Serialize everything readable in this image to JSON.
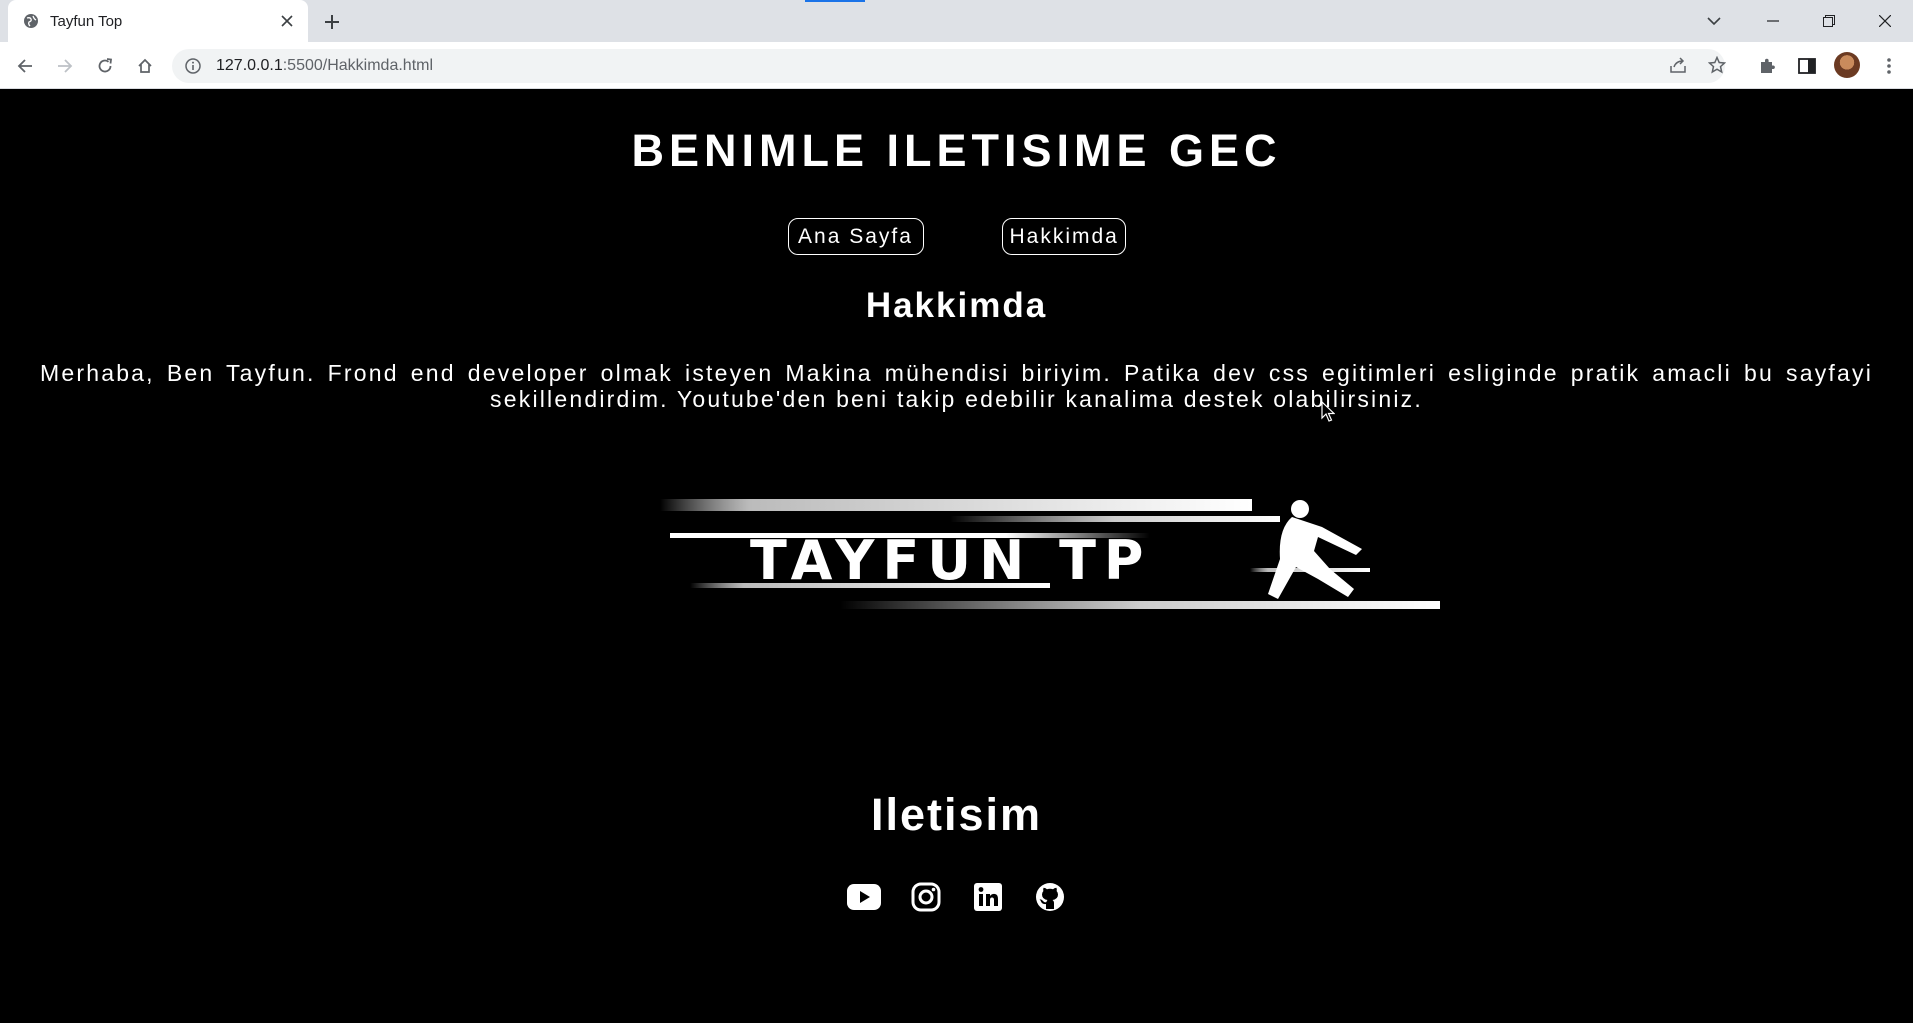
{
  "browser": {
    "tab_title": "Tayfun Top",
    "url_host": "127.0.0.1",
    "url_path": ":5500/Hakkimda.html",
    "icons": {
      "favicon": "globe-icon",
      "close": "close-icon",
      "new_tab": "plus-icon",
      "tab_search": "chevron-down-icon",
      "minimize": "minimize-icon",
      "restore": "restore-icon",
      "window_close": "close-icon",
      "back": "back-arrow-icon",
      "forward": "forward-arrow-icon",
      "reload": "reload-icon",
      "home": "home-icon",
      "site_info": "info-icon",
      "share": "share-icon",
      "bookmark": "star-icon",
      "extensions": "puzzle-icon",
      "side_panel": "side-panel-icon",
      "profile": "avatar",
      "menu": "kebab-menu-icon"
    }
  },
  "page": {
    "site_title": "BENIMLE ILETISIME GEC",
    "nav": [
      {
        "label": "Ana Sayfa"
      },
      {
        "label": "Hakkimda"
      }
    ],
    "section_title": "Hakkimda",
    "about_text": "Merhaba, Ben Tayfun. Frond end developer olmak isteyen Makina mühendisi biriyim. Patika dev css egitimleri esliginde pratik amacli bu sayfayi sekillendirdim. Youtube'den beni takip edebilir kanalima destek olabilirsiniz.",
    "logo_text": "TAYFUN TP",
    "contact_title": "Iletisim",
    "socials": [
      "youtube-icon",
      "instagram-icon",
      "linkedin-icon",
      "github-icon"
    ],
    "colors": {
      "background": "#000000",
      "text": "#ffffff"
    }
  }
}
